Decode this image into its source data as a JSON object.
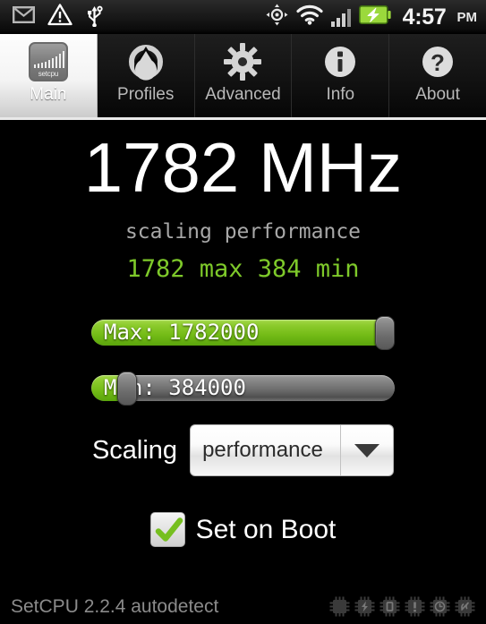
{
  "status_bar": {
    "icons_left": [
      "mail-icon",
      "warning-triangle-icon",
      "usb-icon"
    ],
    "icons_right": [
      "gps-crosshair-icon",
      "wifi-icon",
      "signal-bars-icon",
      "battery-charging-icon"
    ],
    "time": "4:57",
    "ampm": "PM",
    "signal_bars_active": 3,
    "signal_bars_total": 4
  },
  "tabs": [
    {
      "label": "Main",
      "icon": "setcpu-logo-icon",
      "selected": true
    },
    {
      "label": "Profiles",
      "icon": "droplet-gear-icon",
      "selected": false
    },
    {
      "label": "Advanced",
      "icon": "gear-icon",
      "selected": false
    },
    {
      "label": "Info",
      "icon": "info-circle-icon",
      "selected": false
    },
    {
      "label": "About",
      "icon": "question-circle-icon",
      "selected": false
    }
  ],
  "main": {
    "current_frequency": "1782 MHz",
    "governor_line": "scaling performance",
    "range_line": "1782 max 384 min",
    "sliders": [
      {
        "name": "max",
        "label": "Max: 1782000",
        "fill_percent": 100,
        "thumb_percent": 100
      },
      {
        "name": "min",
        "label": "Min: 384000",
        "fill_percent": 9,
        "thumb_percent": 9
      }
    ],
    "scaling": {
      "caption": "Scaling",
      "selected_value": "performance",
      "dropdown_icon": "chevron-down-icon"
    },
    "set_on_boot": {
      "label": "Set on Boot",
      "checked": true,
      "check_icon": "checkmark-icon"
    }
  },
  "bottom_bar": {
    "text": "SetCPU 2.2.4 autodetect",
    "chips": [
      "chip-plain-icon",
      "chip-bolt-icon",
      "chip-screen-icon",
      "chip-alert-icon",
      "chip-clock-icon",
      "chip-phone-icon"
    ]
  },
  "colors": {
    "accent_green": "#7ec92a",
    "slider_green": "#8ccb2d",
    "background": "#000000",
    "tab_selected_bg": "#f4f4f4",
    "muted_text": "#a8a8a8"
  }
}
